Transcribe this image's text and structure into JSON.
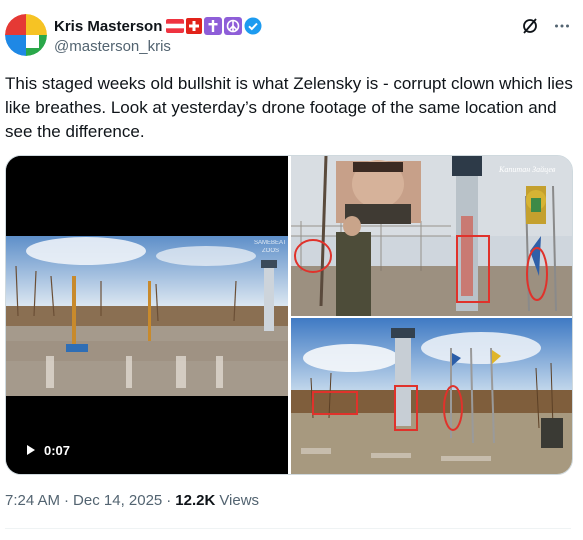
{
  "author": {
    "display_name": "Kris Masterson",
    "handle": "@masterson_kris",
    "badges": [
      "austria-flag-icon",
      "swiss-flag-icon",
      "latin-cross-icon",
      "peace-symbol-icon",
      "verified-badge-icon"
    ]
  },
  "tweet": {
    "text": "This staged weeks old bullshit is what Zelensky is - corrupt clown which lies like breathes. Look at yesterday’s drone footage of the same location and see the difference."
  },
  "media": {
    "video_duration": "0:07",
    "left_watermark": "SAMEBEAT\nZOOS",
    "right_watermark": "Капитан Зайцев"
  },
  "meta": {
    "time": "7:24 AM",
    "separator": "·",
    "date": "Dec 14, 2025",
    "views_count": "12.2K",
    "views_label": "Views"
  },
  "colors": {
    "verified_blue": "#1d9bf0",
    "secondary_text": "#536471",
    "primary_text": "#0f1419"
  }
}
